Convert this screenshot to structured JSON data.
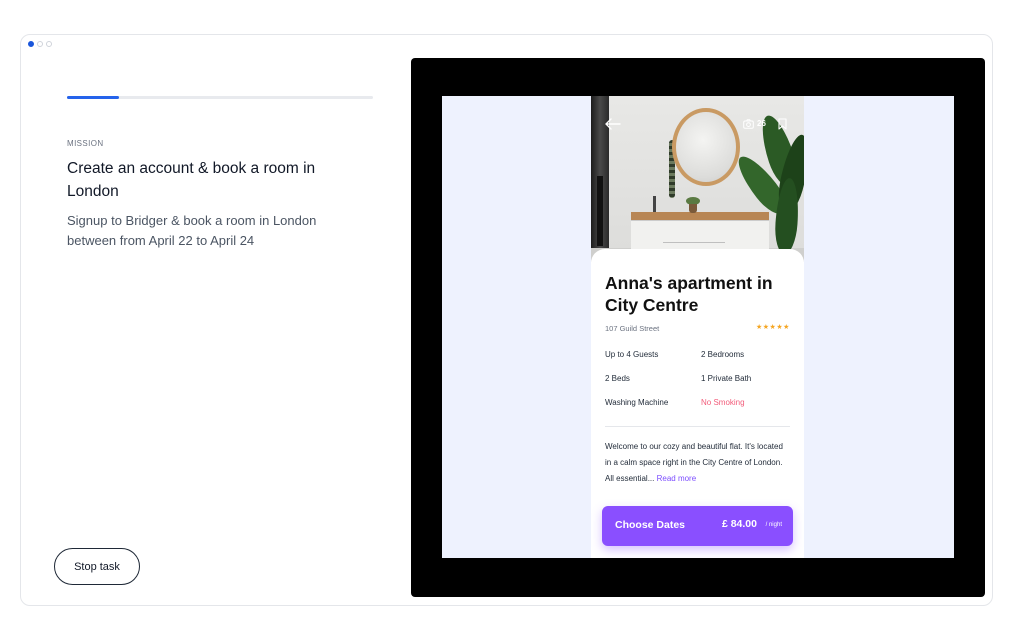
{
  "task_panel": {
    "progress_percent": 17,
    "mission_label": "MISSION",
    "mission_title": "Create an account & book a room in London",
    "mission_description": "Signup to Bridger & book a room in London between from April 22 to April 24",
    "stop_button_label": "Stop task"
  },
  "listing": {
    "photo_count": "26",
    "title": "Anna's apartment in City Centre",
    "address": "107  Guild Street",
    "rating_stars": "★★★★★",
    "amenities": [
      {
        "label": "Up to 4 Guests"
      },
      {
        "label": "2 Bedrooms"
      },
      {
        "label": "2 Beds"
      },
      {
        "label": "1 Private Bath"
      },
      {
        "label": "Washing Machine"
      },
      {
        "label": "No Smoking",
        "status": "warning"
      }
    ],
    "description": "Welcome to our cozy and beautiful flat. It's located in a calm space right in the City Centre of London. All essential...",
    "read_more_label": "Read more",
    "cta_label": "Choose Dates",
    "price": "£ 84.00",
    "price_unit": "/ night"
  },
  "colors": {
    "accent_blue": "#2563eb",
    "cta_purple": "#8a4fff",
    "star_orange": "#f5a623",
    "warning_pink": "#f25c7a",
    "canvas_bg": "#eef2fe"
  },
  "icons": {
    "back": "arrow-left-icon",
    "camera": "camera-icon",
    "bookmark": "bookmark-icon"
  }
}
